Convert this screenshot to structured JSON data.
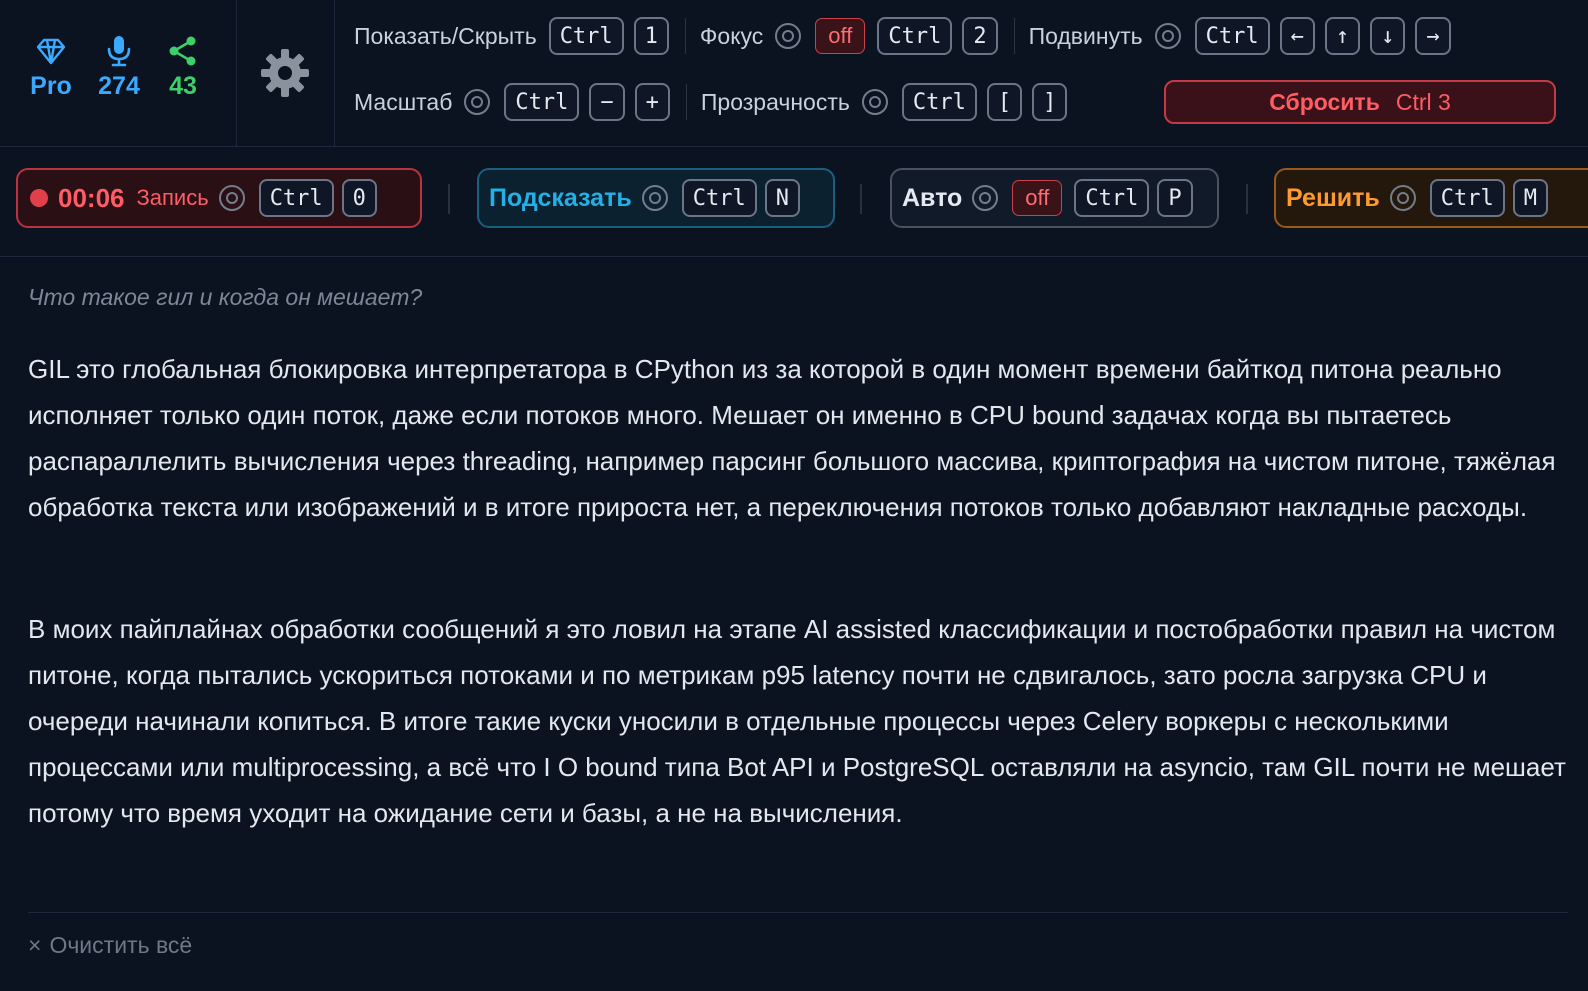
{
  "stats": {
    "plan": {
      "label": "Pro",
      "icon": "diamond-icon",
      "color": "#3aa9ff"
    },
    "mic": {
      "value": "274",
      "icon": "microphone-icon",
      "color": "#3aa9ff"
    },
    "share": {
      "value": "43",
      "icon": "share-icon",
      "color": "#3ccf6a"
    }
  },
  "settings": {
    "icon": "gear-icon"
  },
  "row1": {
    "show_hide": {
      "label": "Показать/Скрыть",
      "keys": [
        "Ctrl",
        "1"
      ]
    },
    "focus": {
      "label": "Фокус",
      "state": "off",
      "keys": [
        "Ctrl",
        "2"
      ]
    },
    "move": {
      "label": "Подвинуть",
      "keys": [
        "Ctrl",
        "←",
        "↑",
        "↓",
        "→"
      ]
    }
  },
  "row2": {
    "scale": {
      "label": "Масштаб",
      "keys": [
        "Ctrl",
        "−",
        "+"
      ]
    },
    "opacity": {
      "label": "Прозрачность",
      "keys": [
        "Ctrl",
        "[",
        "]"
      ]
    },
    "reset": {
      "label": "Сбросить",
      "shortcut": "Ctrl 3"
    }
  },
  "actions": {
    "record": {
      "time": "00:06",
      "label": "Запись",
      "keys": [
        "Ctrl",
        "0"
      ]
    },
    "hint": {
      "label": "Подсказать",
      "keys": [
        "Ctrl",
        "N"
      ]
    },
    "auto": {
      "label": "Авто",
      "state": "off",
      "keys": [
        "Ctrl",
        "P"
      ]
    },
    "solve": {
      "label": "Решить",
      "keys": [
        "Ctrl",
        "M"
      ]
    }
  },
  "content": {
    "question": "Что такое гил и когда он мешает?",
    "paragraph1": "GIL это глобальная блокировка интерпретатора в CPython из за которой в один момент времени байткод питона реально исполняет только один поток, даже если потоков много. Мешает он именно в CPU bound задачах когда вы пытаетесь распараллелить вычисления через threading, например парсинг большого массива, криптография на чистом питоне, тяжёлая обработка текста или изображений и в итоге прироста нет, а переключения потоков только добавляют накладные расходы.",
    "paragraph2": "В моих пайплайнах обработки сообщений я это ловил на этапе AI assisted классификации и постобработки правил на чистом питоне, когда пытались ускориться потоками и по метрикам p95 latency почти не сдвигалось, зато росла загрузка CPU и очереди начинали копиться. В итоге такие куски уносили в отдельные процессы через Celery воркеры с несколькими процессами или multiprocessing, а всё что I O bound типа Bot API и PostgreSQL оставляли на asyncio, там GIL почти не мешает потому что время уходит на ожидание сети и базы, а не на вычисления."
  },
  "footer": {
    "clear_label": "Очистить всё",
    "clear_icon": "×"
  }
}
